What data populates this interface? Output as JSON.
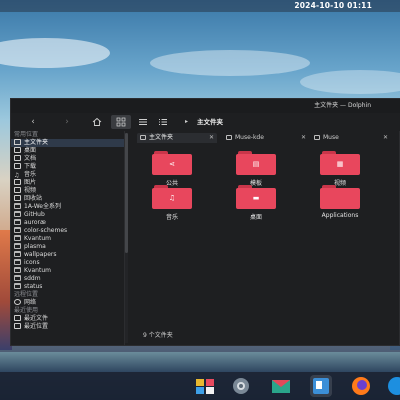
{
  "topbar": {
    "clock": "2024-10-10 01:11"
  },
  "window": {
    "title": "主文件夹 — Dolphin",
    "breadcrumb": "主文件夹",
    "tabs": [
      {
        "label": "主文件夹",
        "active": true
      },
      {
        "label": "Muse-kde",
        "active": false
      },
      {
        "label": "Muse",
        "active": false
      }
    ]
  },
  "sidebar": {
    "sections": [
      {
        "heading": "常用位置",
        "items": [
          "主文件夹",
          "桌面",
          "文档",
          "下载",
          "音乐",
          "图片",
          "视频",
          "回收站",
          "1A-We全系列",
          "GitHub",
          "auroræ",
          "color-schemes",
          "Kvantum",
          "plasma",
          "wallpapers",
          "icons",
          "Kvantum",
          "sddm",
          "status"
        ]
      },
      {
        "heading": "远程位置",
        "items": [
          "网络"
        ]
      },
      {
        "heading": "最近使用",
        "items": [
          "最近文件",
          "最近位置"
        ]
      }
    ]
  },
  "files": [
    {
      "name": "公共",
      "emblem": "share"
    },
    {
      "name": "模板",
      "emblem": "template"
    },
    {
      "name": "视频",
      "emblem": "video"
    },
    {
      "name": "音乐",
      "emblem": "music"
    },
    {
      "name": "桌面",
      "emblem": "desktop"
    },
    {
      "name": "Applications",
      "emblem": "none"
    }
  ],
  "status": {
    "text": "9 个文件夹"
  },
  "colors": {
    "folder": "#e8475d",
    "folder_tab": "#c9364a",
    "window_bg": "#1e1f21",
    "selection": "#2f3a4a"
  }
}
